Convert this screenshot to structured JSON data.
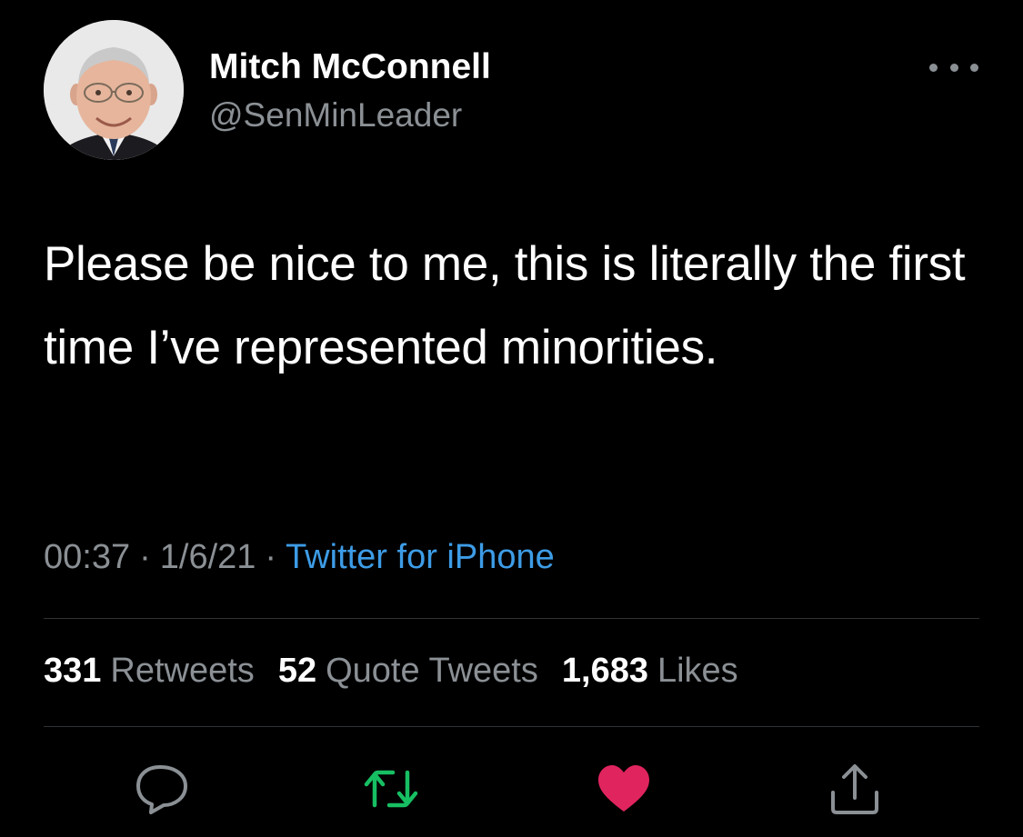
{
  "user": {
    "display_name": "Mitch McConnell",
    "handle": "@SenMinLeader"
  },
  "tweet": {
    "text": "Please be nice to me, this is literally the first time I’ve represented minorities.",
    "time": "00:37",
    "separator": "·",
    "date": "1/6/21",
    "source": "Twitter for iPhone"
  },
  "stats": {
    "retweets_count": "331",
    "retweets_label": "Retweets",
    "quotes_count": "52",
    "quotes_label": "Quote Tweets",
    "likes_count": "1,683",
    "likes_label": "Likes"
  },
  "actions": {
    "reply_icon": "reply-icon",
    "retweet_icon": "retweet-icon",
    "like_icon": "heart-icon",
    "share_icon": "share-icon"
  },
  "colors": {
    "background": "#000000",
    "text": "#ffffff",
    "secondary_text": "#8b9095",
    "link": "#3d9ce6",
    "retweet": "#17bf63",
    "like": "#e0245e",
    "divider": "#2f3336"
  }
}
